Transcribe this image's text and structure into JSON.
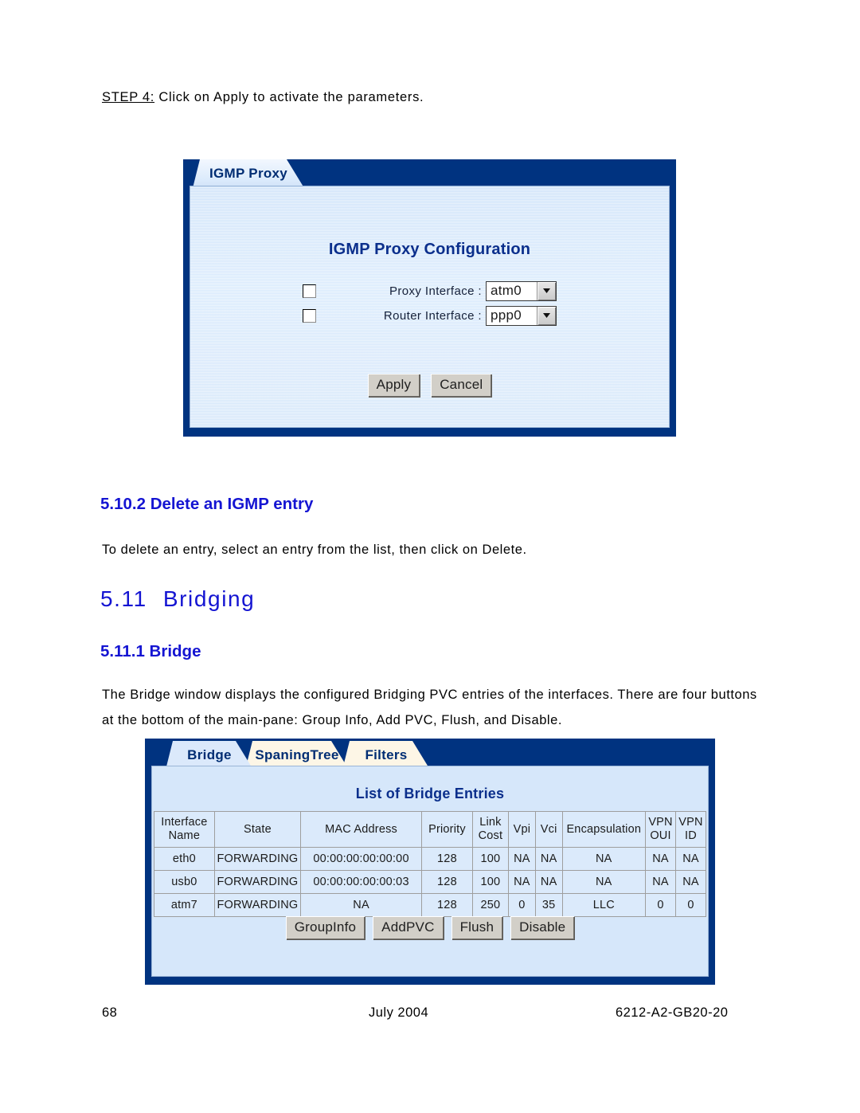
{
  "step": {
    "label": "STEP 4:",
    "text": "Click on Apply to activate the parameters."
  },
  "igmp_window": {
    "tab_label": "IGMP Proxy",
    "title": "IGMP Proxy Configuration",
    "rows": [
      {
        "label": "Proxy Interface :",
        "value": "atm0",
        "checked": false
      },
      {
        "label": "Router Interface :",
        "value": "ppp0",
        "checked": false
      }
    ],
    "buttons": [
      {
        "label": "Apply"
      },
      {
        "label": "Cancel"
      }
    ]
  },
  "section_delete": {
    "heading": "5.10.2 Delete an IGMP entry",
    "body": "To delete an entry, select an entry from the list, then click on Delete."
  },
  "section_bridging": {
    "number": "5.11",
    "title": "Bridging"
  },
  "section_bridge": {
    "heading": "5.11.1 Bridge",
    "body": "The Bridge window displays the configured Bridging PVC entries of the interfaces. There are four buttons at the bottom of the main-pane: Group Info, Add PVC, Flush, and Disable."
  },
  "bridge_window": {
    "tabs": [
      {
        "label": "Bridge",
        "active": true
      },
      {
        "label": "SpaningTree",
        "active": false
      },
      {
        "label": "Filters",
        "active": false
      }
    ],
    "title": "List of Bridge Entries",
    "table": {
      "columns": [
        "Interface Name",
        "State",
        "MAC Address",
        "Priority",
        "Link Cost",
        "Vpi",
        "Vci",
        "Encapsulation",
        "VPN OUI",
        "VPN ID"
      ],
      "rows": [
        {
          "interface_name": "eth0",
          "state": "FORWARDING",
          "mac_address": "00:00:00:00:00:00",
          "priority": "128",
          "link_cost": "100",
          "vpi": "NA",
          "vci": "NA",
          "encapsulation": "NA",
          "vpn_oui": "NA",
          "vpn_id": "NA"
        },
        {
          "interface_name": "usb0",
          "state": "FORWARDING",
          "mac_address": "00:00:00:00:00:03",
          "priority": "128",
          "link_cost": "100",
          "vpi": "NA",
          "vci": "NA",
          "encapsulation": "NA",
          "vpn_oui": "NA",
          "vpn_id": "NA"
        },
        {
          "interface_name": "atm7",
          "state": "FORWARDING",
          "mac_address": "NA",
          "priority": "128",
          "link_cost": "250",
          "vpi": "0",
          "vci": "35",
          "encapsulation": "LLC",
          "vpn_oui": "0",
          "vpn_id": "0"
        }
      ]
    },
    "buttons": [
      {
        "label": "GroupInfo"
      },
      {
        "label": "AddPVC"
      },
      {
        "label": "Flush"
      },
      {
        "label": "Disable"
      }
    ]
  },
  "footer": {
    "page_number": "68",
    "date": "July 2004",
    "doc_number": "6212-A2-GB20-20"
  },
  "colors": {
    "window_border": "#003380",
    "window_body": "#d6e7fa",
    "heading_blue": "#1414d2",
    "title_blue": "#0b2f8c",
    "tab_active": "#dbe9fb",
    "tab_idle": "#fdf6e6",
    "button_face": "#d2cfc8"
  }
}
